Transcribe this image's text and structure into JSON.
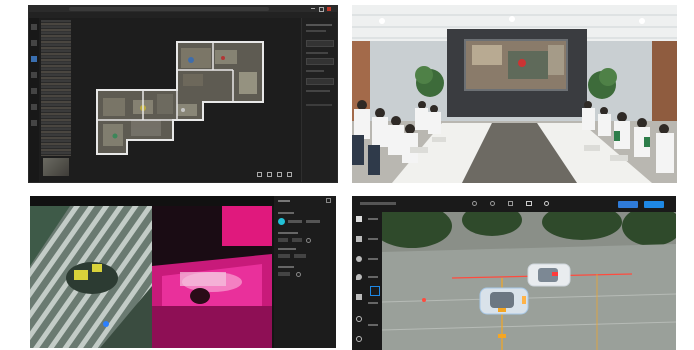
{
  "panels": {
    "top_left": {
      "description_name": "floorplan-software-window",
      "toolbar_icons": [
        "fit-icon",
        "grid-icon",
        "expand-icon",
        "close-icon"
      ]
    },
    "top_right": {
      "description_name": "meeting-room-photo"
    },
    "bottom_left": {
      "description_name": "inspection-render-view"
    },
    "bottom_right": {
      "description_name": "drone-map-app",
      "header_buttons": [
        {
          "color": "#2f7bd9"
        },
        {
          "color": "#1e88e5"
        }
      ],
      "toolbar_icons": [
        "undo-icon",
        "redo-icon",
        "measure-icon",
        "layers-icon",
        "camera-icon"
      ]
    }
  },
  "colors": {
    "dark_ui": "#1b1b1b",
    "wall_white": "#e8e8e8",
    "accent_cyan": "#22c1d6",
    "accent_pink": "#ff2ea6",
    "accent_red": "#ff4b3e",
    "accent_orange": "#f5a623",
    "accent_blue": "#1e88e5"
  }
}
